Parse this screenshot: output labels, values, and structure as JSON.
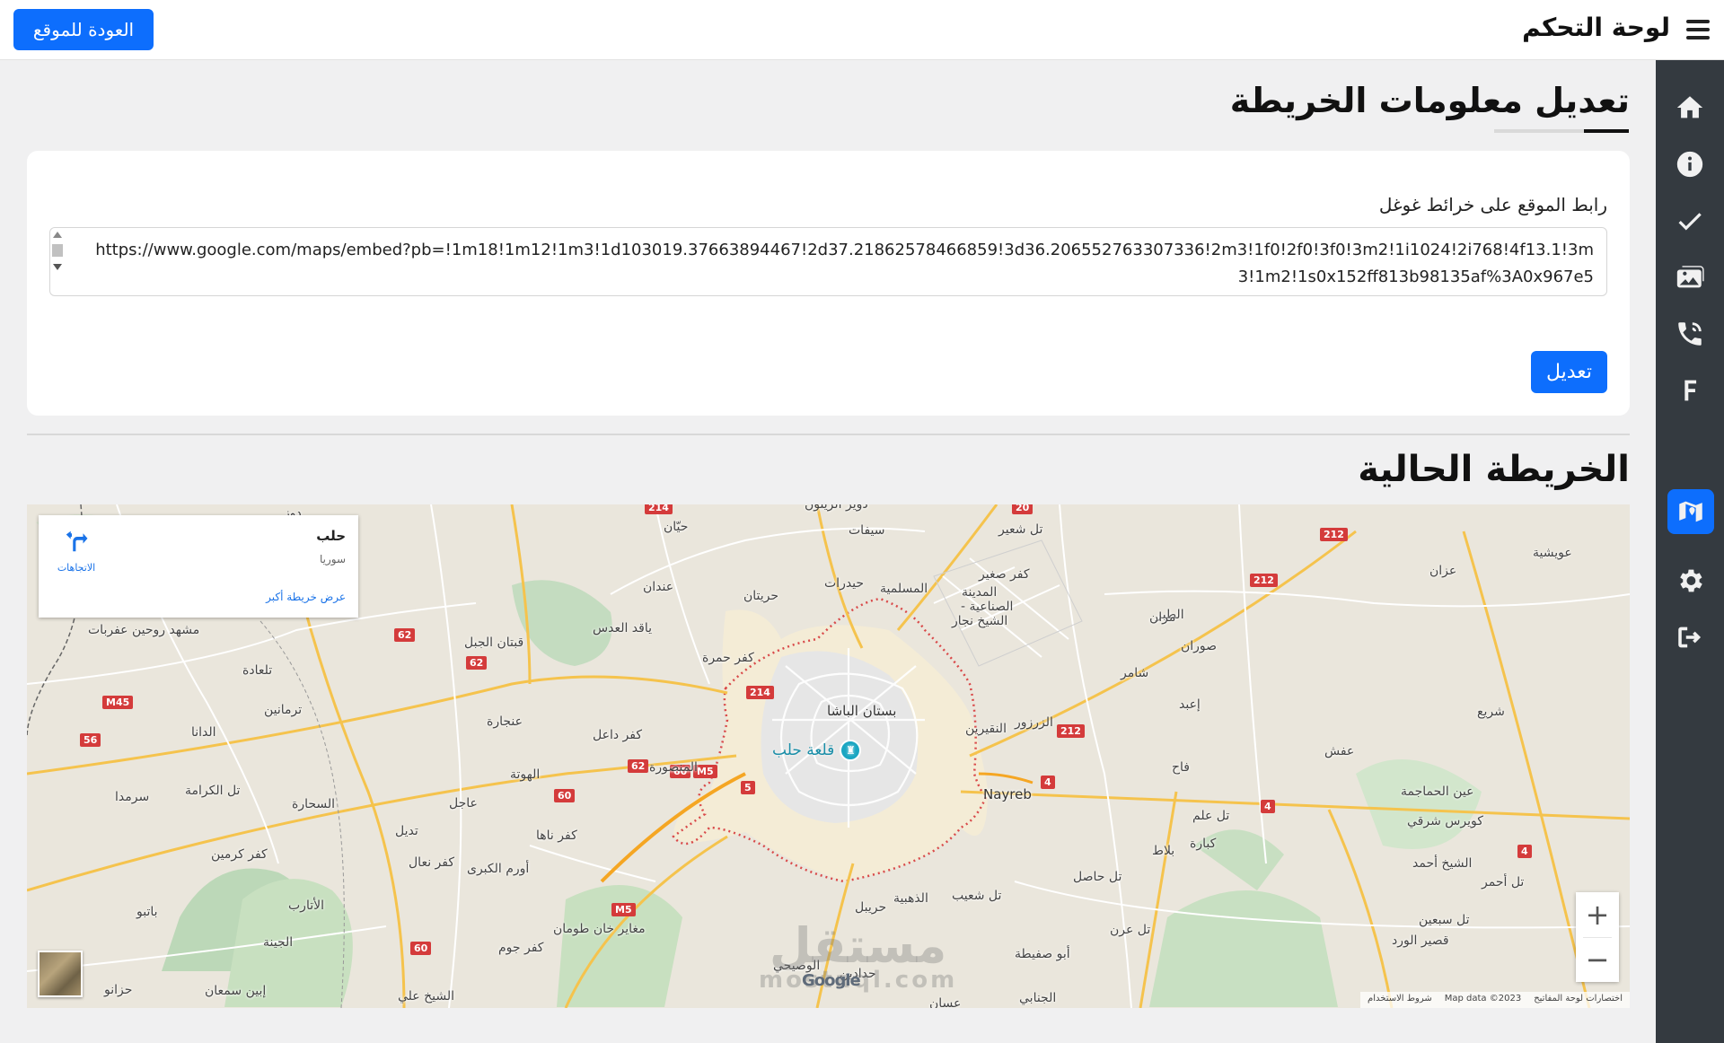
{
  "header": {
    "title": "لوحة التحكم",
    "back_button": "العودة للموقع",
    "menu_icon": "hamburger-icon"
  },
  "sidebar": {
    "items": [
      {
        "icon": "home-icon",
        "active": false
      },
      {
        "icon": "info-icon",
        "active": false
      },
      {
        "icon": "check-icon",
        "active": false
      },
      {
        "icon": "gallery-icon",
        "active": false
      },
      {
        "icon": "phone-icon",
        "active": false
      },
      {
        "icon": "facebook-icon",
        "active": false
      },
      {
        "icon": "map-icon",
        "active": true
      },
      {
        "icon": "settings-icon",
        "active": false
      },
      {
        "icon": "logout-icon",
        "active": false
      }
    ],
    "active_color": "#0d6efd"
  },
  "edit_section": {
    "heading": "تعديل معلومات الخريطة",
    "field_label": "رابط الموقع على خرائط غوغل",
    "url_value": "https://www.google.com/maps/embed?pb=!1m18!1m12!1m3!1d103019.37663894467!2d37.21862578466859!3d36.206552763307336!2m3!1f0!2f0!3f0!3m2!1i1024!2i768!4f13.1!3m3!1m2!1s0x152ff813b98135af%3A0x967e5",
    "submit_button": "تعديل"
  },
  "current_map": {
    "heading": "الخريطة الحالية",
    "info_card": {
      "place_name": "حلب",
      "country": "سوريا",
      "directions_label": "الاتجاهات",
      "larger_map_link": "عرض خريطة أكبر"
    },
    "landmark": "قلعة حلب",
    "places": {
      "p1": "مشهد روحين عفربات",
      "p2": "تلعادة",
      "p3": "ترمانين",
      "p4": "الدانا",
      "p5": "تل الكرامة",
      "p6": "سرمدا",
      "p7": "السحارة",
      "p8": "كفر كرمين",
      "p9": "الأتارب",
      "p10": "باتبو",
      "p11": "الجينة",
      "p12": "إبين سمعان",
      "p13": "حزانو",
      "p14": "قبتان الجبل",
      "p15": "عنجارة",
      "p16": "الهوتة",
      "p17": "عاجل",
      "p18": "تديل",
      "p19": "كفر نعال",
      "p20": "أورم الكبرى",
      "p21": "كفر ناها",
      "p22": "كفر داعل",
      "p23": "المنصورة",
      "p24": "كفر حمرة",
      "p25": "ياقد العدس",
      "p26": "عندان",
      "p27": "حيّان",
      "p28": "حريتان",
      "p29": "حيدرات",
      "p30": "سيفات",
      "p31": "دوير الزيتون",
      "p32": "المسلمية",
      "p33": "تل شعير",
      "p34": "كفر صغير",
      "p35": "المدينة",
      "p36": "الصناعية -",
      "p37": "الشيخ نجار",
      "p38": "بستان الباشا",
      "p39": "الزرزور",
      "p40": "النقيرين",
      "p41": "Nayreb",
      "p42": "الطبر",
      "p43": "مران",
      "p44": "صوران",
      "p45": "شامر",
      "p46": "إعبد",
      "p47": "فاح",
      "p48": "عفش",
      "p49": "عزان",
      "p50": "عويشية",
      "p51": "شريع",
      "p52": "عين الحماجمة",
      "p53": "كويرس شرقي",
      "p54": "الشيخ أحمد",
      "p55": "تل أحمر",
      "p56": "تل علم",
      "p57": "كبارة",
      "p58": "بلاط",
      "p59": "تل حاصل",
      "p60": "تل عرن",
      "p61": "تل سبعين",
      "p62": "قصير الورد",
      "p63": "حريبل",
      "p64": "الذهبية",
      "p65": "تل شعيب",
      "p66": "أبو صفيطة",
      "p67": "الجنابي",
      "p68": "مغاير خان طومان",
      "p69": "كفر جوم",
      "p70": "الوصيحي",
      "p71": "حدادين",
      "p72": "الشيخ علي",
      "p73": "عسان",
      "p74": "دوز"
    },
    "roads": [
      "214",
      "20",
      "212",
      "212",
      "62",
      "62",
      "M45",
      "56",
      "214",
      "60",
      "M5",
      "5",
      "60",
      "M5",
      "60",
      "62",
      "212",
      "4",
      "4",
      "4"
    ],
    "zoom_in": "+",
    "zoom_out": "−",
    "google_logo": "Google",
    "attribution": {
      "shortcuts": "اختصارات لوحة المفاتيح",
      "map_data": "Map data ©2023",
      "terms": "شروط الاستخدام"
    },
    "watermark": {
      "line1": "مستقل",
      "line2": "mostaql.com"
    }
  }
}
